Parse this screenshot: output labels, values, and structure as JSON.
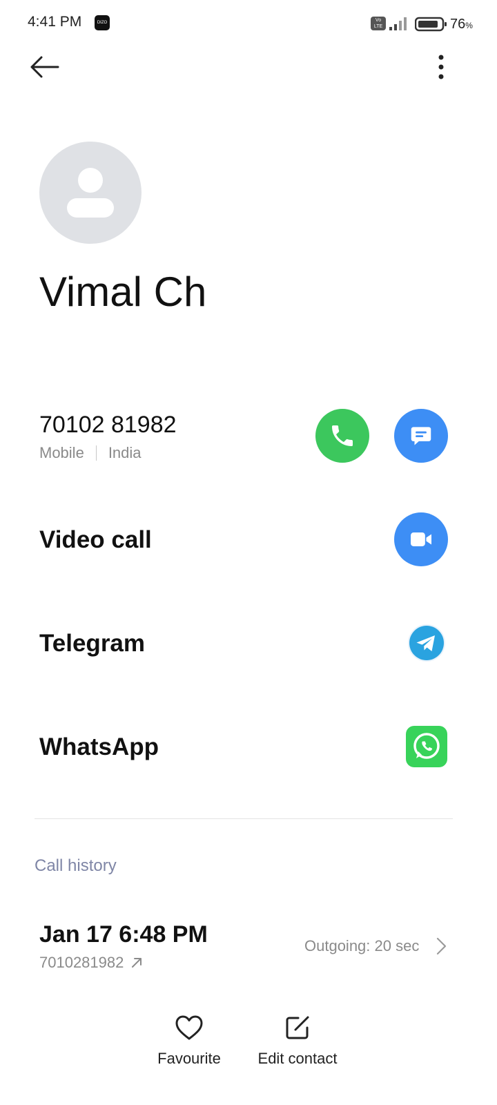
{
  "status_bar": {
    "time": "4:41 PM",
    "app_badge": "DIZO",
    "volte": "Vo LTE",
    "battery_percent": "76",
    "battery_unit": "%"
  },
  "contact": {
    "name": "Vimal Ch"
  },
  "phone": {
    "number": "70102 81982",
    "type": "Mobile",
    "region": "India"
  },
  "rows": {
    "video_call": "Video call",
    "telegram": "Telegram",
    "whatsapp": "WhatsApp"
  },
  "call_history": {
    "title": "Call history",
    "entries": [
      {
        "datetime": "Jan 17 6:48 PM",
        "number": "7010281982",
        "status": "Outgoing: 20 sec"
      }
    ]
  },
  "bottom_bar": {
    "favourite": "Favourite",
    "edit_contact": "Edit contact"
  },
  "colors": {
    "call": "#3cc75d",
    "message": "#3d8ef5",
    "video": "#3d8ef5",
    "whatsapp": "#38d35a",
    "telegram": "#2aa3e0",
    "section_title": "#7f86a6"
  },
  "icons": [
    "back-arrow-icon",
    "more-vert-icon",
    "phone-icon",
    "message-icon",
    "video-icon",
    "telegram-icon",
    "whatsapp-icon",
    "outgoing-arrow-icon",
    "chevron-right-icon",
    "heart-icon",
    "edit-icon"
  ]
}
